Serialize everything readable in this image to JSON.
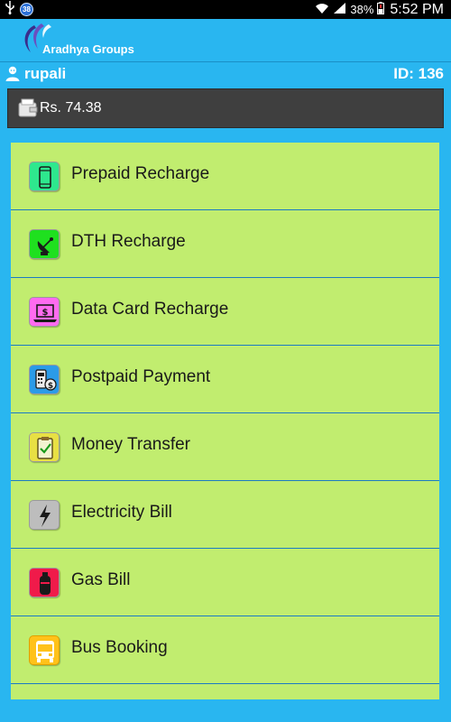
{
  "status_bar": {
    "notification_count": "38",
    "battery": "38%",
    "time": "5:52 PM"
  },
  "app": {
    "title": "Aradhya Groups"
  },
  "user": {
    "name": "rupali",
    "id_label": "ID: 136"
  },
  "balance": {
    "text": "Rs. 74.38"
  },
  "menu": {
    "items": [
      {
        "label": "Prepaid Recharge",
        "icon": "mobile-phone-icon",
        "color": "#2ee88e"
      },
      {
        "label": "DTH Recharge",
        "icon": "satellite-dish-icon",
        "color": "#1fe01f"
      },
      {
        "label": "Data Card Recharge",
        "icon": "laptop-dollar-icon",
        "color": "#ff6bf0"
      },
      {
        "label": "Postpaid Payment",
        "icon": "bill-payment-icon",
        "color": "#2b9be8"
      },
      {
        "label": "Money Transfer",
        "icon": "clipboard-check-icon",
        "color": "#e8e044"
      },
      {
        "label": "Electricity Bill",
        "icon": "lightning-icon",
        "color": "#bdbdbd"
      },
      {
        "label": "Gas Bill",
        "icon": "gas-cylinder-icon",
        "color": "#f01a4a"
      },
      {
        "label": "Bus Booking",
        "icon": "bus-icon",
        "color": "#ffc21a"
      }
    ]
  }
}
